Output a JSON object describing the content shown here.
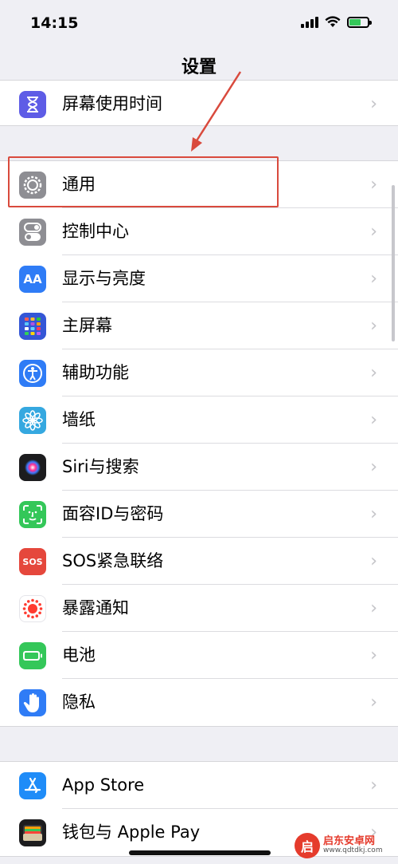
{
  "status_bar": {
    "time": "14:15"
  },
  "header": {
    "title": "设置"
  },
  "group_top": [
    {
      "label": "屏幕使用时间",
      "icon": "hourglass-icon",
      "color": "#5e5ce6"
    }
  ],
  "group_main": [
    {
      "label": "通用",
      "icon": "gear-icon",
      "color": "#8e8e93"
    },
    {
      "label": "控制中心",
      "icon": "toggle-icon",
      "color": "#8e8e93"
    },
    {
      "label": "显示与亮度",
      "icon": "text-size-icon",
      "color": "#2f7cf6"
    },
    {
      "label": "主屏幕",
      "icon": "app-grid-icon",
      "color": "#3456d6"
    },
    {
      "label": "辅助功能",
      "icon": "accessibility-icon",
      "color": "#2f7cf6"
    },
    {
      "label": "墙纸",
      "icon": "flower-icon",
      "color": "#35a8e0"
    },
    {
      "label": "Siri与搜索",
      "icon": "siri-icon",
      "color": "#1c1c1e"
    },
    {
      "label": "面容ID与密码",
      "icon": "face-id-icon",
      "color": "#34c759"
    },
    {
      "label": "SOS紧急联络",
      "icon": "sos-icon",
      "color": "#e5473c"
    },
    {
      "label": "暴露通知",
      "icon": "exposure-icon",
      "color": "#ffffff"
    },
    {
      "label": "电池",
      "icon": "battery-icon",
      "color": "#34c759"
    },
    {
      "label": "隐私",
      "icon": "hand-icon",
      "color": "#2f7cf6"
    }
  ],
  "group_bottom": [
    {
      "label": "App Store",
      "icon": "app-store-icon",
      "color": "#1f8cf8"
    },
    {
      "label": "钱包与 Apple Pay",
      "icon": "wallet-icon",
      "color": "#1c1c1e"
    }
  ],
  "sos_text": "SOS",
  "text_size_glyph": "AA",
  "watermark": {
    "name": "启东安卓网",
    "url": "www.qdtdkj.com",
    "logo_char": "启"
  }
}
